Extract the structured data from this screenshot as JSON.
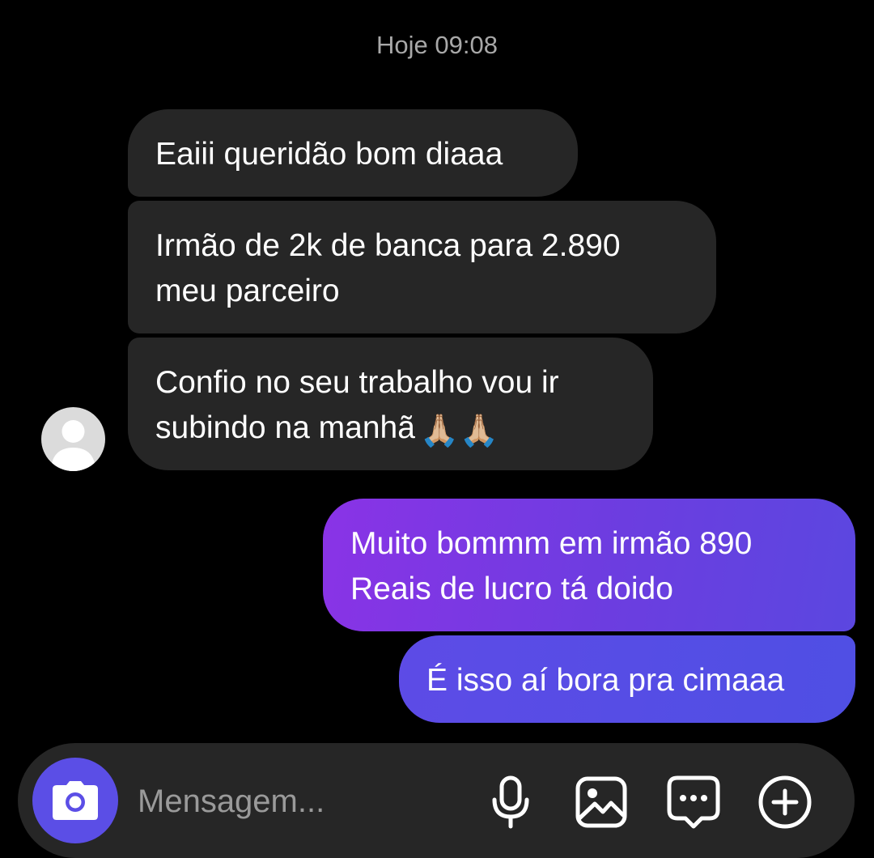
{
  "chat": {
    "timestamp": "Hoje 09:08",
    "messages": [
      {
        "direction": "incoming",
        "lines": [
          "Eaiii queridão bom diaaa"
        ]
      },
      {
        "direction": "incoming",
        "lines": [
          "Irmão de 2k de banca para 2.890",
          "meu parceiro"
        ]
      },
      {
        "direction": "incoming",
        "lines": [
          "Confio no seu trabalho vou ir",
          "subindo na manhã"
        ],
        "emoji": "🙏🏼🙏🏼"
      },
      {
        "direction": "outgoing",
        "lines": [
          "Muito bommm em irmão 890",
          "Reais de lucro tá doido"
        ]
      },
      {
        "direction": "outgoing",
        "lines": [
          "É isso aí bora pra cimaaa"
        ]
      }
    ]
  },
  "composer": {
    "placeholder": "Mensagem...",
    "value": "",
    "icons": [
      "camera-icon",
      "microphone-icon",
      "gallery-icon",
      "sticker-icon",
      "plus-icon"
    ]
  },
  "colors": {
    "background": "#000000",
    "incoming_bubble": "#262626",
    "outgoing_gradient_start": "#8a33e6",
    "outgoing_gradient_end": "#5b47e0",
    "accent": "#5b4ee6",
    "timestamp": "#a8a8a8"
  }
}
